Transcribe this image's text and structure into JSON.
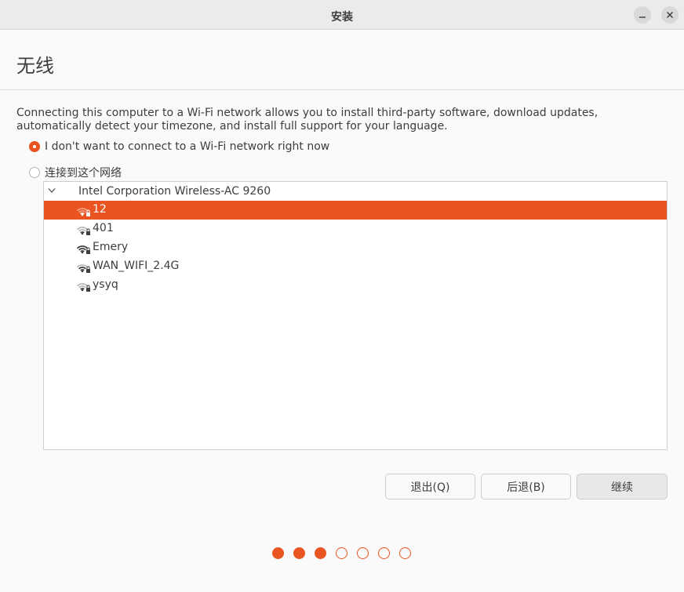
{
  "window": {
    "title": "安装"
  },
  "page": {
    "heading": "无线"
  },
  "description": "Connecting this computer to a Wi-Fi network allows you to install third-party software, download updates, automatically detect your timezone, and install full support for your language.",
  "options": [
    {
      "label": "I don't want to connect to a Wi-Fi network right now",
      "checked": true
    },
    {
      "label": "连接到这个网络",
      "checked": false
    }
  ],
  "network_list": {
    "device": "Intel Corporation Wireless-AC 9260",
    "networks": [
      {
        "name": "12",
        "selected": true,
        "icon": "wifi-weak-locked-icon",
        "bars": 1
      },
      {
        "name": "401",
        "selected": false,
        "icon": "wifi-weak-locked-icon",
        "bars": 1
      },
      {
        "name": "Emery",
        "selected": false,
        "icon": "wifi-strong-locked-icon",
        "bars": 4
      },
      {
        "name": "WAN_WIFI_2.4G",
        "selected": false,
        "icon": "wifi-medium-locked-icon",
        "bars": 2
      },
      {
        "name": "ysyq",
        "selected": false,
        "icon": "wifi-weak-locked-icon",
        "bars": 1
      }
    ]
  },
  "buttons": {
    "quit": "退出(Q)",
    "back": "后退(B)",
    "continue": "继续"
  },
  "progress": {
    "total_steps": 7,
    "completed_steps": 3
  },
  "colors": {
    "accent": "#e95420",
    "background": "#fafafa",
    "text": "#3d3d3d"
  }
}
